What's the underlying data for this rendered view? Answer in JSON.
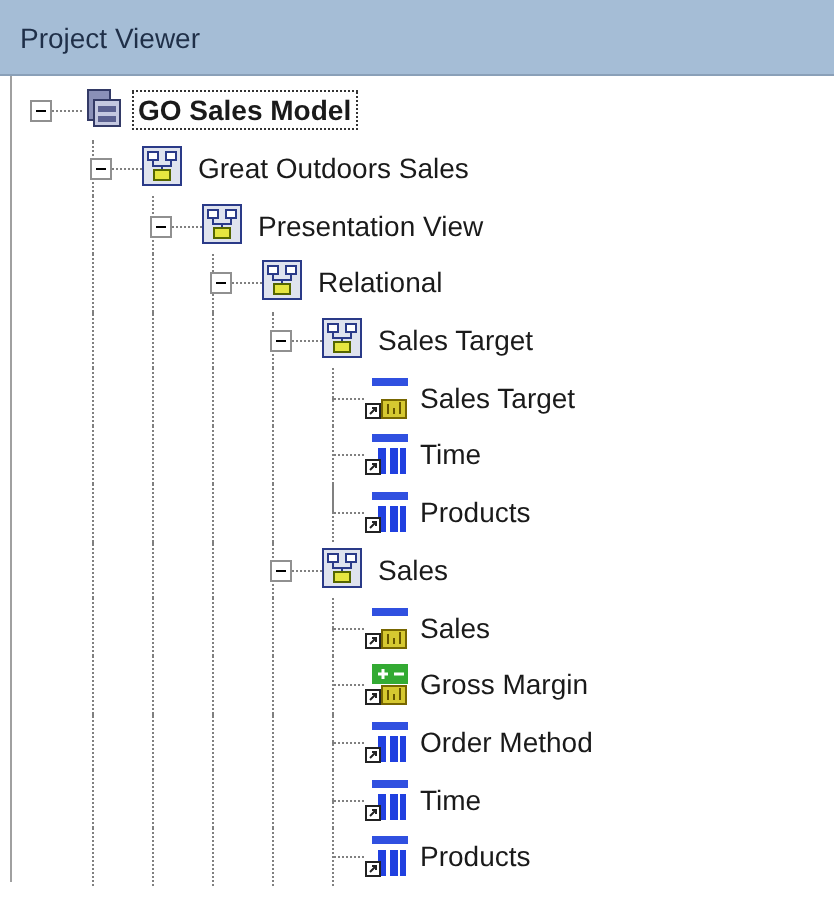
{
  "panel": {
    "title": "Project Viewer"
  },
  "tree": [
    {
      "label": "GO Sales Model",
      "kind": "model",
      "selected": true,
      "expanded": true,
      "children": [
        {
          "label": "Great Outdoors Sales",
          "kind": "namespace",
          "selected": false,
          "expanded": true,
          "children": [
            {
              "label": "Presentation View",
              "kind": "namespace",
              "selected": false,
              "expanded": true,
              "children": [
                {
                  "label": "Relational",
                  "kind": "namespace",
                  "selected": false,
                  "expanded": true,
                  "children": [
                    {
                      "label": "Sales Target",
                      "kind": "namespace",
                      "selected": false,
                      "expanded": true,
                      "children": [
                        {
                          "label": "Sales Target",
                          "kind": "measure",
                          "selected": false
                        },
                        {
                          "label": "Time",
                          "kind": "dimension",
                          "selected": false
                        },
                        {
                          "label": "Products",
                          "kind": "dimension",
                          "selected": false
                        }
                      ]
                    },
                    {
                      "label": "Sales",
                      "kind": "namespace",
                      "selected": false,
                      "expanded": true,
                      "children": [
                        {
                          "label": "Sales",
                          "kind": "measure",
                          "selected": false
                        },
                        {
                          "label": "Gross Margin",
                          "kind": "calculation",
                          "selected": false
                        },
                        {
                          "label": "Order Method",
                          "kind": "dimension",
                          "selected": false
                        },
                        {
                          "label": "Time",
                          "kind": "dimension",
                          "selected": false
                        },
                        {
                          "label": "Products",
                          "kind": "dimension",
                          "selected": false
                        }
                      ]
                    }
                  ]
                }
              ]
            }
          ]
        }
      ]
    }
  ]
}
